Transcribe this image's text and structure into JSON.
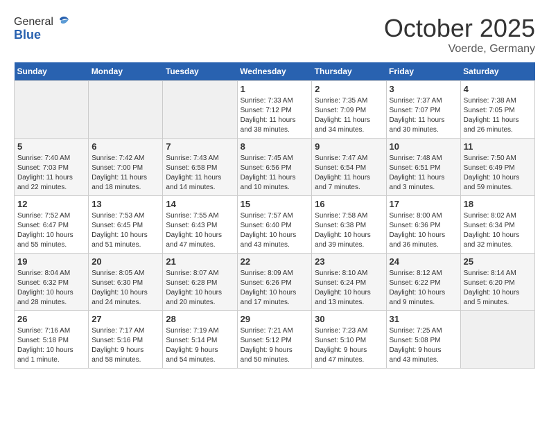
{
  "header": {
    "logo_general": "General",
    "logo_blue": "Blue",
    "month": "October 2025",
    "location": "Voerde, Germany"
  },
  "weekdays": [
    "Sunday",
    "Monday",
    "Tuesday",
    "Wednesday",
    "Thursday",
    "Friday",
    "Saturday"
  ],
  "weeks": [
    [
      {
        "day": "",
        "info": ""
      },
      {
        "day": "",
        "info": ""
      },
      {
        "day": "",
        "info": ""
      },
      {
        "day": "1",
        "info": "Sunrise: 7:33 AM\nSunset: 7:12 PM\nDaylight: 11 hours\nand 38 minutes."
      },
      {
        "day": "2",
        "info": "Sunrise: 7:35 AM\nSunset: 7:09 PM\nDaylight: 11 hours\nand 34 minutes."
      },
      {
        "day": "3",
        "info": "Sunrise: 7:37 AM\nSunset: 7:07 PM\nDaylight: 11 hours\nand 30 minutes."
      },
      {
        "day": "4",
        "info": "Sunrise: 7:38 AM\nSunset: 7:05 PM\nDaylight: 11 hours\nand 26 minutes."
      }
    ],
    [
      {
        "day": "5",
        "info": "Sunrise: 7:40 AM\nSunset: 7:03 PM\nDaylight: 11 hours\nand 22 minutes."
      },
      {
        "day": "6",
        "info": "Sunrise: 7:42 AM\nSunset: 7:00 PM\nDaylight: 11 hours\nand 18 minutes."
      },
      {
        "day": "7",
        "info": "Sunrise: 7:43 AM\nSunset: 6:58 PM\nDaylight: 11 hours\nand 14 minutes."
      },
      {
        "day": "8",
        "info": "Sunrise: 7:45 AM\nSunset: 6:56 PM\nDaylight: 11 hours\nand 10 minutes."
      },
      {
        "day": "9",
        "info": "Sunrise: 7:47 AM\nSunset: 6:54 PM\nDaylight: 11 hours\nand 7 minutes."
      },
      {
        "day": "10",
        "info": "Sunrise: 7:48 AM\nSunset: 6:51 PM\nDaylight: 11 hours\nand 3 minutes."
      },
      {
        "day": "11",
        "info": "Sunrise: 7:50 AM\nSunset: 6:49 PM\nDaylight: 10 hours\nand 59 minutes."
      }
    ],
    [
      {
        "day": "12",
        "info": "Sunrise: 7:52 AM\nSunset: 6:47 PM\nDaylight: 10 hours\nand 55 minutes."
      },
      {
        "day": "13",
        "info": "Sunrise: 7:53 AM\nSunset: 6:45 PM\nDaylight: 10 hours\nand 51 minutes."
      },
      {
        "day": "14",
        "info": "Sunrise: 7:55 AM\nSunset: 6:43 PM\nDaylight: 10 hours\nand 47 minutes."
      },
      {
        "day": "15",
        "info": "Sunrise: 7:57 AM\nSunset: 6:40 PM\nDaylight: 10 hours\nand 43 minutes."
      },
      {
        "day": "16",
        "info": "Sunrise: 7:58 AM\nSunset: 6:38 PM\nDaylight: 10 hours\nand 39 minutes."
      },
      {
        "day": "17",
        "info": "Sunrise: 8:00 AM\nSunset: 6:36 PM\nDaylight: 10 hours\nand 36 minutes."
      },
      {
        "day": "18",
        "info": "Sunrise: 8:02 AM\nSunset: 6:34 PM\nDaylight: 10 hours\nand 32 minutes."
      }
    ],
    [
      {
        "day": "19",
        "info": "Sunrise: 8:04 AM\nSunset: 6:32 PM\nDaylight: 10 hours\nand 28 minutes."
      },
      {
        "day": "20",
        "info": "Sunrise: 8:05 AM\nSunset: 6:30 PM\nDaylight: 10 hours\nand 24 minutes."
      },
      {
        "day": "21",
        "info": "Sunrise: 8:07 AM\nSunset: 6:28 PM\nDaylight: 10 hours\nand 20 minutes."
      },
      {
        "day": "22",
        "info": "Sunrise: 8:09 AM\nSunset: 6:26 PM\nDaylight: 10 hours\nand 17 minutes."
      },
      {
        "day": "23",
        "info": "Sunrise: 8:10 AM\nSunset: 6:24 PM\nDaylight: 10 hours\nand 13 minutes."
      },
      {
        "day": "24",
        "info": "Sunrise: 8:12 AM\nSunset: 6:22 PM\nDaylight: 10 hours\nand 9 minutes."
      },
      {
        "day": "25",
        "info": "Sunrise: 8:14 AM\nSunset: 6:20 PM\nDaylight: 10 hours\nand 5 minutes."
      }
    ],
    [
      {
        "day": "26",
        "info": "Sunrise: 7:16 AM\nSunset: 5:18 PM\nDaylight: 10 hours\nand 1 minute."
      },
      {
        "day": "27",
        "info": "Sunrise: 7:17 AM\nSunset: 5:16 PM\nDaylight: 9 hours\nand 58 minutes."
      },
      {
        "day": "28",
        "info": "Sunrise: 7:19 AM\nSunset: 5:14 PM\nDaylight: 9 hours\nand 54 minutes."
      },
      {
        "day": "29",
        "info": "Sunrise: 7:21 AM\nSunset: 5:12 PM\nDaylight: 9 hours\nand 50 minutes."
      },
      {
        "day": "30",
        "info": "Sunrise: 7:23 AM\nSunset: 5:10 PM\nDaylight: 9 hours\nand 47 minutes."
      },
      {
        "day": "31",
        "info": "Sunrise: 7:25 AM\nSunset: 5:08 PM\nDaylight: 9 hours\nand 43 minutes."
      },
      {
        "day": "",
        "info": ""
      }
    ]
  ]
}
